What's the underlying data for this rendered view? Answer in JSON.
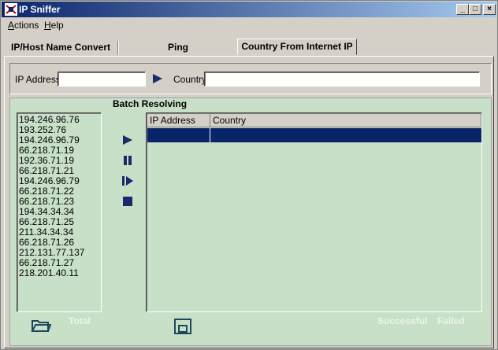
{
  "window": {
    "title": "IP Sniffer",
    "minimize": "_",
    "maximize": "□",
    "close": "×"
  },
  "menu": {
    "actions_first": "A",
    "actions_rest": "ctions",
    "help_first": "H",
    "help_rest": "elp"
  },
  "tabs": [
    {
      "label": "IP/Host Name Convert"
    },
    {
      "label": "Ping"
    },
    {
      "label": "Country From Internet IP"
    }
  ],
  "lookup": {
    "ip_label": "IP Address",
    "ip_value": "",
    "country_label": "Country",
    "country_value": ""
  },
  "batch": {
    "title": "Batch Resolving",
    "ip_list": [
      "194.246.96.76",
      "193.252.76",
      "194.246.96.79",
      "66.218.71.19",
      "192.36.71.19",
      "66.218.71.21",
      "194.246.96.79",
      "66.218.71.22",
      "66.218.71.23",
      "194.34.34.34",
      "66.218.71.25",
      "211.34.34.34",
      "66.218.71.26",
      "212.131.77.137",
      "66.218.71.27",
      "218.201.40.11"
    ],
    "grid_headers": {
      "ip": "IP Address",
      "country": "Country"
    },
    "total_label": "Total",
    "successful_label": "Successful",
    "failed_label": "Failed"
  },
  "colors": {
    "accent": "#0a246a",
    "batch_bg": "#c8e0c8",
    "control_icon": "#1a2a6a"
  },
  "icons": [
    "app-icon",
    "play-icon",
    "pause-icon",
    "step-icon",
    "stop-icon",
    "open-folder-icon",
    "save-icon"
  ]
}
